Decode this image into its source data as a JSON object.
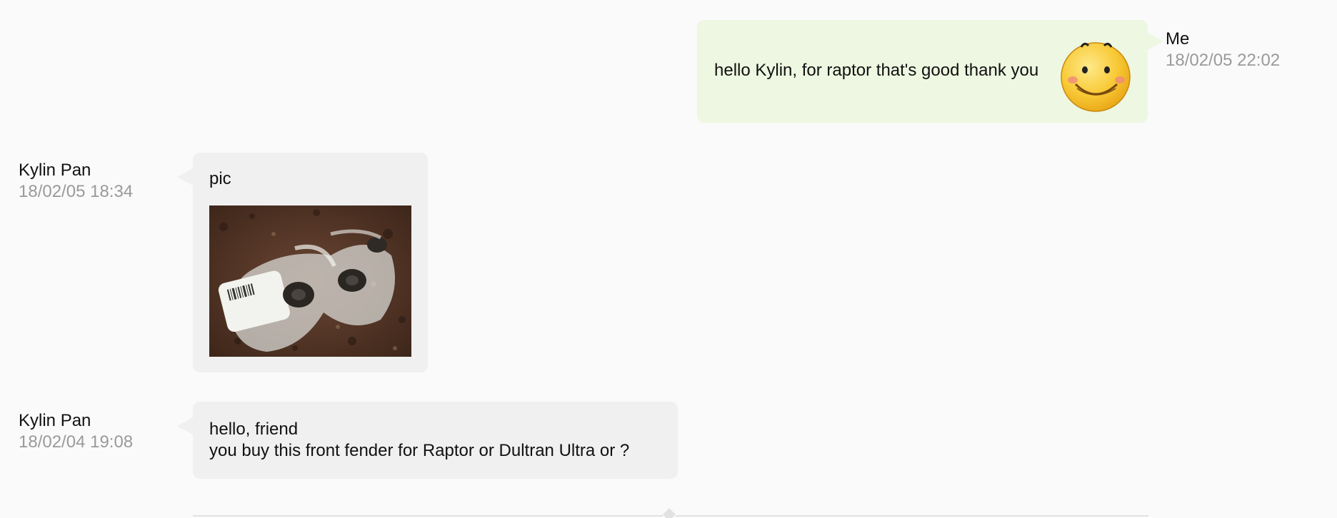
{
  "messages": [
    {
      "sender": "Me",
      "time": "18/02/05 22:02",
      "text": "hello Kylin, for raptor that's good thank you",
      "emoji": "smiley-face-icon"
    },
    {
      "sender": "Kylin Pan",
      "time": "18/02/05 18:34",
      "text": "pic",
      "image": "photo-of-wrapped-parts"
    },
    {
      "sender": "Kylin Pan",
      "time": "18/02/04 19:08",
      "lines": [
        "hello, friend",
        "you buy this front fender for Raptor or Dultran Ultra or ?"
      ]
    }
  ],
  "colors": {
    "incoming_bubble": "#f0f0f0",
    "outgoing_bubble": "#eef7e1",
    "timestamp": "#9a9a9a"
  }
}
